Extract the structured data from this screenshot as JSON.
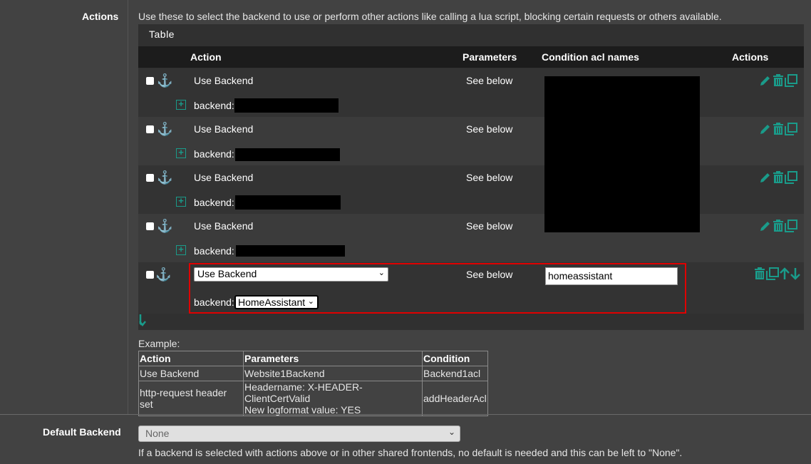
{
  "actions_section": {
    "label": "Actions",
    "help": "Use these to select the backend to use or perform other actions like calling a lua script, blocking certain requests or others available."
  },
  "table": {
    "title": "Table",
    "columns": [
      "Action",
      "Parameters",
      "Condition acl names",
      "Actions"
    ],
    "rows": [
      {
        "action": "Use Backend",
        "parameters": "See below",
        "detail_label": "backend:"
      },
      {
        "action": "Use Backend",
        "parameters": "See below",
        "detail_label": "backend:"
      },
      {
        "action": "Use Backend",
        "parameters": "See below",
        "detail_label": "backend:"
      },
      {
        "action": "Use Backend",
        "parameters": "See below",
        "detail_label": "backend:"
      }
    ],
    "edit_row": {
      "action_select": "Use Backend",
      "parameters": "See below",
      "condition_value": "homeassistant",
      "detail_label": "backend:",
      "backend_select": "HomeAssistant"
    }
  },
  "example": {
    "caption": "Example:",
    "headers": [
      "Action",
      "Parameters",
      "Condition"
    ],
    "rows": [
      [
        "Use Backend",
        "Website1Backend",
        "Backend1acl"
      ],
      [
        "http-request header set",
        "Headername: X-HEADER-ClientCertValid",
        "addHeaderAcl"
      ]
    ],
    "row2_param_line2": "New logformat value: YES"
  },
  "default_backend": {
    "label": "Default Backend",
    "selected": "None",
    "help": "If a backend is selected with actions above or in other shared frontends, no default is needed and this can be left to \"None\"."
  },
  "colors": {
    "accent": "#1a9b8a",
    "highlight": "#e00000"
  }
}
